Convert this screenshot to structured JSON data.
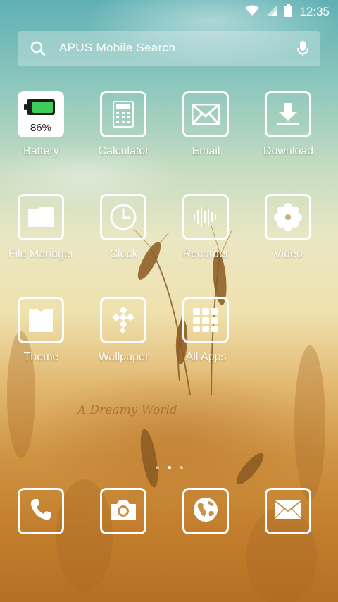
{
  "status_bar": {
    "time": "12:35"
  },
  "search": {
    "text": "APUS Mobile Search"
  },
  "apps": [
    {
      "label": "Battery",
      "icon": "battery-icon"
    },
    {
      "label": "Calculator",
      "icon": "calculator-icon"
    },
    {
      "label": "Email",
      "icon": "email-icon"
    },
    {
      "label": "Download",
      "icon": "download-icon"
    },
    {
      "label": "File Manager",
      "icon": "folder-icon"
    },
    {
      "label": "Clock",
      "icon": "clock-icon"
    },
    {
      "label": "Recorder",
      "icon": "recorder-icon"
    },
    {
      "label": "Video",
      "icon": "flower-icon"
    },
    {
      "label": "Theme",
      "icon": "shirt-icon"
    },
    {
      "label": "Wallpaper",
      "icon": "wallpaper-icon"
    },
    {
      "label": "All Apps",
      "icon": "all-apps-icon"
    }
  ],
  "battery": {
    "percent_text": "86%",
    "level": 0.86,
    "fill_color": "#3ecc5a"
  },
  "wallpaper_caption": "A Dreamy World",
  "page_indicator": {
    "pages": 3,
    "active": 2
  },
  "dock": [
    {
      "icon": "phone-icon"
    },
    {
      "icon": "camera-icon"
    },
    {
      "icon": "browser-globe-icon"
    },
    {
      "icon": "messages-envelope-icon"
    }
  ]
}
